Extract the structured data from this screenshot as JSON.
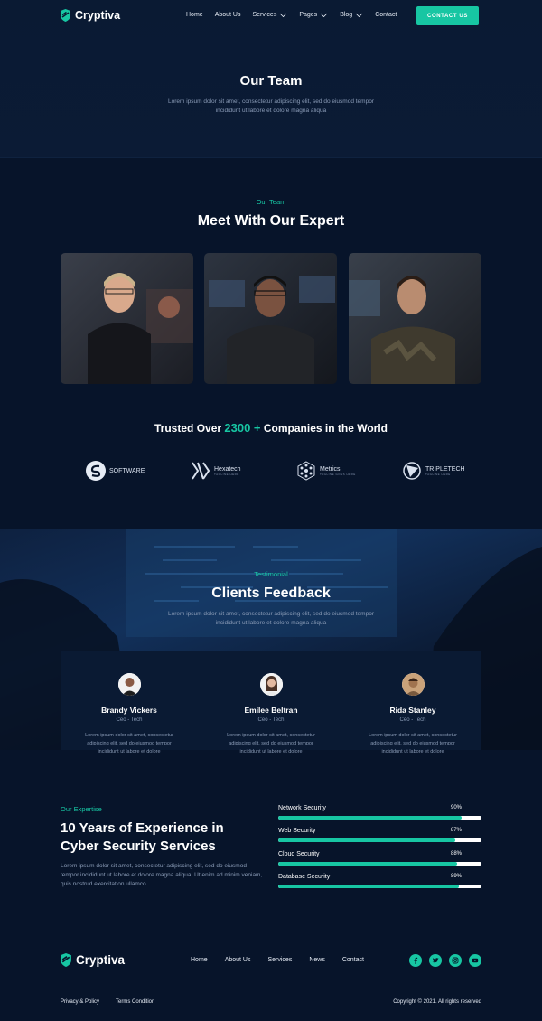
{
  "brand": {
    "name": "Cryptiva"
  },
  "nav": {
    "items": [
      {
        "label": "Home",
        "dropdown": false
      },
      {
        "label": "About Us",
        "dropdown": false
      },
      {
        "label": "Services",
        "dropdown": true
      },
      {
        "label": "Pages",
        "dropdown": true
      },
      {
        "label": "Blog",
        "dropdown": true
      },
      {
        "label": "Contact",
        "dropdown": false
      }
    ],
    "cta": "CONTACT US"
  },
  "hero": {
    "title": "Our Team",
    "desc": "Lorem ipsum dolor sit amet, consectetur adipiscing elit, sed do eiusmod tempor incididunt ut labore et dolore magna aliqua"
  },
  "team": {
    "eyebrow": "Our Team",
    "title": "Meet With Our Expert"
  },
  "trusted": {
    "prefix": "Trusted Over",
    "number": "2300 +",
    "suffix": "Companies in the World"
  },
  "partners": [
    {
      "name": "SOFTWARE",
      "sub": ""
    },
    {
      "name": "Hexatech",
      "sub": "TAGLINE HERE"
    },
    {
      "name": "Metrics",
      "sub": "TAGLINE GOES HERE"
    },
    {
      "name": "TRIPLETECH",
      "sub": "TAGLINE HERE"
    }
  ],
  "feedback": {
    "eyebrow": "Testimonial",
    "title": "Clients Feedback",
    "desc": "Lorem ipsum dolor sit amet, consectetur adipiscing elit, sed do eiusmod tempor incididunt ut labore et dolore magna aliqua",
    "people": [
      {
        "name": "Brandy Vickers",
        "role": "Ceo - Tech",
        "text": "Lorem ipsum dolor sit amet, consectetur adipiscing elit, sed do eiusmod tempor incididunt ut labore et dolore"
      },
      {
        "name": "Emilee Beltran",
        "role": "Ceo - Tech",
        "text": "Lorem ipsum dolor sit amet, consectetur adipiscing elit, sed do eiusmod tempor incididunt ut labore et dolore"
      },
      {
        "name": "Rida Stanley",
        "role": "Ceo - Tech",
        "text": "Lorem ipsum dolor sit amet, consectetur adipiscing elit, sed do eiusmod tempor incididunt ut labore et dolore"
      }
    ]
  },
  "expertise": {
    "eyebrow": "Our Expertise",
    "title": "10 Years of Experience in Cyber Security Services",
    "desc": "Lorem ipsum dolor sit amet, consectetur adipiscing elit, sed do eiusmod tempor incididunt ut labore et dolore magna aliqua. Ut enim ad minim veniam, quis nostrud exercitation ullamco",
    "skills": [
      {
        "label": "Network Security",
        "pct": "90%",
        "value": 0.9
      },
      {
        "label": "Web Security",
        "pct": "87%",
        "value": 0.87
      },
      {
        "label": "Cloud Security",
        "pct": "88%",
        "value": 0.88
      },
      {
        "label": "Database Security",
        "pct": "89%",
        "value": 0.89
      }
    ]
  },
  "footer": {
    "nav": [
      "Home",
      "About Us",
      "Services",
      "News",
      "Contact"
    ],
    "social": [
      "facebook-icon",
      "twitter-icon",
      "instagram-icon",
      "youtube-icon"
    ],
    "privacy": "Privacy & Policy",
    "terms": "Terms Condition",
    "copyright": "Copyright © 2021. All rights reserved"
  },
  "colors": {
    "accent": "#17c6a3",
    "background": "#07142a",
    "muted": "#8a9bb6"
  }
}
